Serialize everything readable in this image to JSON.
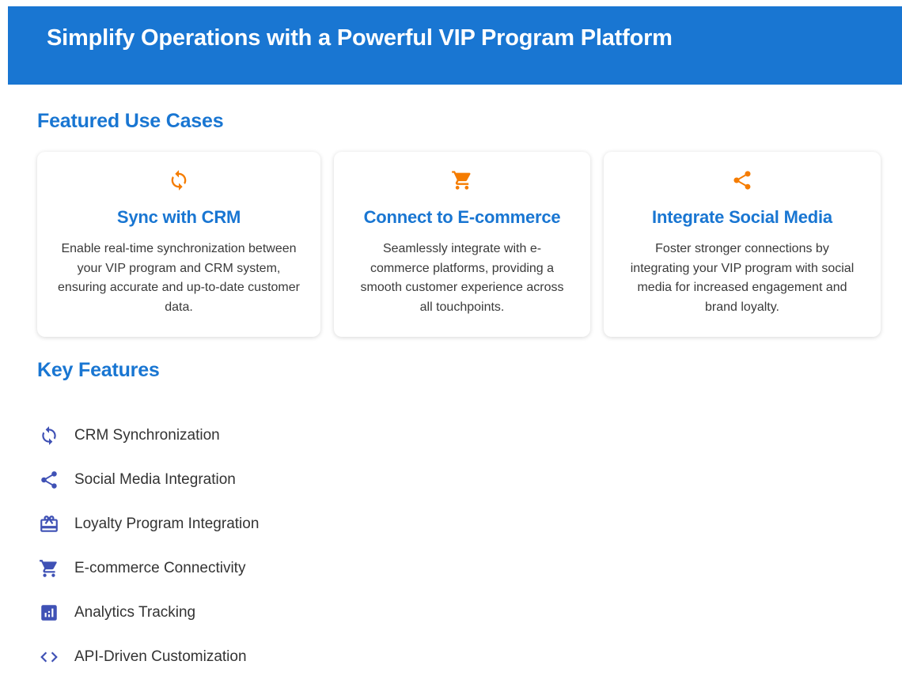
{
  "header": {
    "title": "Simplify Operations with a Powerful VIP Program Platform"
  },
  "colors": {
    "primary": "#1976d2",
    "accent": "#f57c00",
    "icon_indigo": "#3f51b5"
  },
  "use_cases": {
    "title": "Featured Use Cases",
    "cards": [
      {
        "icon": "sync-icon",
        "title": "Sync with CRM",
        "description": "Enable real-time synchronization between your VIP program and CRM system, ensuring accurate and up-to-date customer data."
      },
      {
        "icon": "shopping-cart-icon",
        "title": "Connect to E-commerce",
        "description": "Seamlessly integrate with e-commerce platforms, providing a smooth customer experience across all touchpoints."
      },
      {
        "icon": "share-icon",
        "title": "Integrate Social Media",
        "description": "Foster stronger connections by integrating your VIP program with social media for increased engagement and brand loyalty."
      }
    ]
  },
  "key_features": {
    "title": "Key Features",
    "items": [
      {
        "icon": "sync-icon",
        "label": "CRM Synchronization"
      },
      {
        "icon": "share-icon",
        "label": "Social Media Integration"
      },
      {
        "icon": "loyalty-card-icon",
        "label": "Loyalty Program Integration"
      },
      {
        "icon": "shopping-cart-icon",
        "label": "E-commerce Connectivity"
      },
      {
        "icon": "analytics-icon",
        "label": "Analytics Tracking"
      },
      {
        "icon": "code-icon",
        "label": "API-Driven Customization"
      }
    ]
  }
}
